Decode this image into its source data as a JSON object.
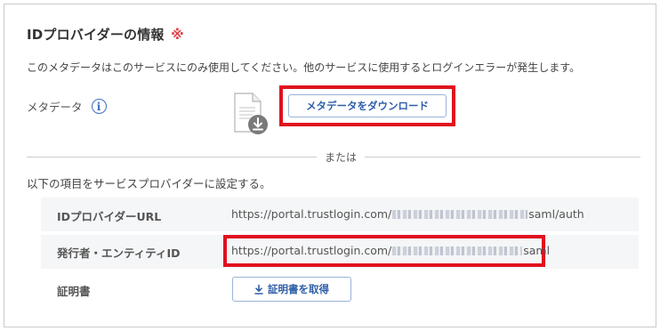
{
  "section": {
    "title": "IDプロバイダーの情報",
    "required_mark": "※",
    "notice": "このメタデータはこのサービスにのみ使用してください。他のサービスに使用するとログインエラーが発生します。"
  },
  "metadata": {
    "label": "メタデータ",
    "info_icon": "i",
    "download_button": "メタデータをダウンロード"
  },
  "divider": {
    "text": "または"
  },
  "manual": {
    "intro": "以下の項目をサービスプロバイダーに設定する。",
    "idp_url": {
      "label": "IDプロバイダーURL",
      "value_prefix": "https://portal.trustlogin.com/",
      "value_suffix": "saml/auth"
    },
    "issuer": {
      "label": "発行者・エンティティID",
      "value_prefix": "https://portal.trustlogin.com/",
      "value_suffix": "saml"
    },
    "certificate": {
      "label": "証明書",
      "button": "証明書を取得"
    }
  },
  "colors": {
    "accent": "#2f5fa8",
    "highlight_border": "#e0111f",
    "required": "#e0454b"
  },
  "icons": [
    "info-icon",
    "document-download-icon",
    "download-icon"
  ]
}
